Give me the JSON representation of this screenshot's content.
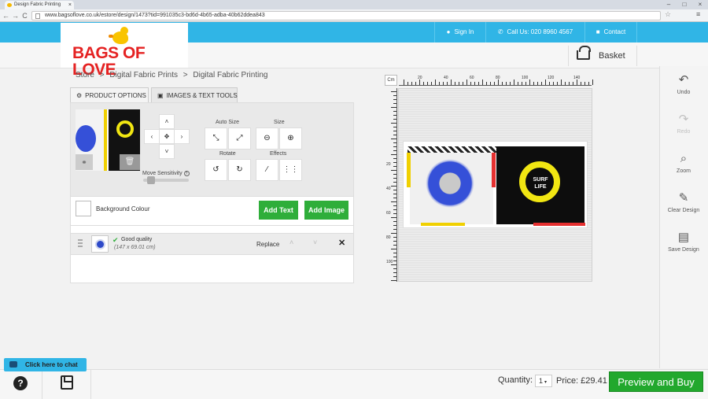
{
  "browser": {
    "tab_title": "Design Fabric Printing",
    "tab_close": "×",
    "url": "www.bagsoflove.co.uk/estore/design/1473?tid=991035c3-bd6d-4b65-adba-40b62ddea843",
    "back": "←",
    "forward": "→",
    "reload": "C",
    "star": "☆",
    "menu": "≡",
    "win_min": "–",
    "win_max": "□",
    "win_close": "×"
  },
  "topbar": {
    "sign_in": "Sign In",
    "call_us": "Call Us: 020 8960 4567",
    "contact": "Contact"
  },
  "logo": {
    "text": "BAGS OF LOVE"
  },
  "header": {
    "basket": "Basket"
  },
  "breadcrumb": {
    "items": [
      "Store",
      "Digital Fabric Prints",
      "Digital Fabric Printing"
    ],
    "separator": ">"
  },
  "tabs": {
    "product_options": "PRODUCT OPTIONS",
    "images_text_tools": "IMAGES & TEXT TOOLS"
  },
  "tools": {
    "move_sensitivity": "Move Sensitivity",
    "help_mark": "?",
    "auto_size": "Auto Size",
    "size": "Size",
    "rotate": "Rotate",
    "effects": "Effects",
    "arrows": {
      "up": "˄",
      "down": "˅",
      "left": "‹",
      "right": "›",
      "center": "✥"
    }
  },
  "background": {
    "label": "Background Colour",
    "add_text": "Add Text",
    "add_image": "Add Image"
  },
  "layer": {
    "quality": "Good quality",
    "dimensions": "(147 x 69.01 cm)",
    "replace": "Replace",
    "up": "˄",
    "down": "˅",
    "remove": "✕"
  },
  "ruler": {
    "unit": "Cm",
    "top_labels": [
      "20",
      "40",
      "60",
      "80",
      "100",
      "120",
      "140"
    ],
    "left_labels": [
      "20",
      "40",
      "60",
      "80",
      "100"
    ]
  },
  "design": {
    "center_text": "SURF\nLIFE"
  },
  "sidebar": {
    "undo": "Undo",
    "redo": "Redo",
    "zoom": "Zoom",
    "clear_design": "Clear Design",
    "save_design": "Save Design",
    "undo_state": "enabled",
    "redo_state": "disabled"
  },
  "chat": {
    "label": "Click here to chat"
  },
  "footer": {
    "quantity_label": "Quantity:",
    "quantity_value": "1",
    "price": "Price: £29.41",
    "preview_buy": "Preview and Buy"
  },
  "colors": {
    "topbar": "#30b5e6",
    "logo_red": "#e52222",
    "green": "#2fae3a",
    "buy_green": "#22a82d"
  }
}
